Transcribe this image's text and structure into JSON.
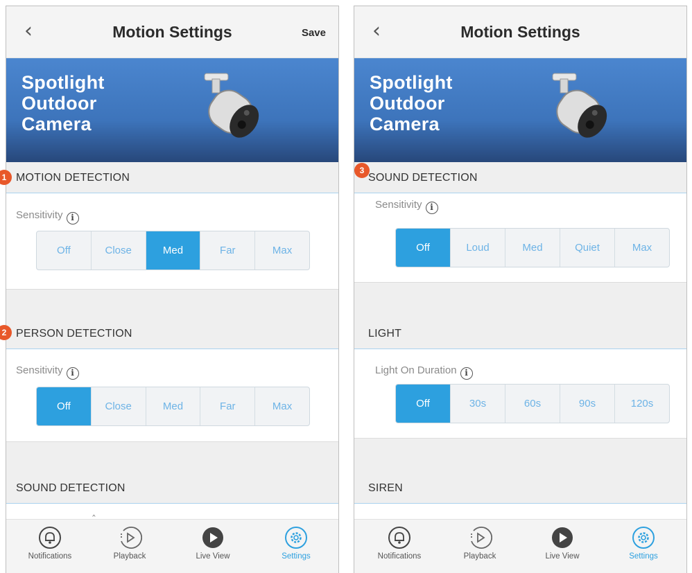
{
  "left_screen": {
    "title": "Motion Settings",
    "save_label": "Save",
    "banner_title": [
      "Spotlight",
      "Outdoor",
      "Camera"
    ],
    "sections": [
      {
        "marker": "1",
        "header": "MOTION DETECTION",
        "row_label": "Sensitivity",
        "options": [
          "Off",
          "Close",
          "Med",
          "Far",
          "Max"
        ],
        "selected": "Med"
      },
      {
        "marker": "2",
        "header": "PERSON DETECTION",
        "row_label": "Sensitivity",
        "options": [
          "Off",
          "Close",
          "Med",
          "Far",
          "Max"
        ],
        "selected": "Off"
      },
      {
        "header": "SOUND DETECTION"
      }
    ]
  },
  "right_screen": {
    "title": "Motion Settings",
    "banner_title": [
      "Spotlight",
      "Outdoor",
      "Camera"
    ],
    "sections": [
      {
        "marker": "3",
        "header": "SOUND DETECTION",
        "row_label": "Sensitivity",
        "options": [
          "Off",
          "Loud",
          "Med",
          "Quiet",
          "Max"
        ],
        "selected": "Off"
      },
      {
        "header": "LIGHT",
        "row_label": "Light On Duration",
        "options": [
          "Off",
          "30s",
          "60s",
          "90s",
          "120s"
        ],
        "selected": "Off"
      },
      {
        "header": "SIREN"
      }
    ]
  },
  "tab_bar": [
    {
      "label": "Notifications",
      "icon": "bell-icon"
    },
    {
      "label": "Playback",
      "icon": "playback-icon"
    },
    {
      "label": "Live View",
      "icon": "live-view-icon"
    },
    {
      "label": "Settings",
      "icon": "settings-gear-icon",
      "active": true
    }
  ],
  "info_glyph": "i",
  "colors": {
    "accent": "#2da0df",
    "banner": "#4b86cf",
    "marker": "#e8582a"
  }
}
